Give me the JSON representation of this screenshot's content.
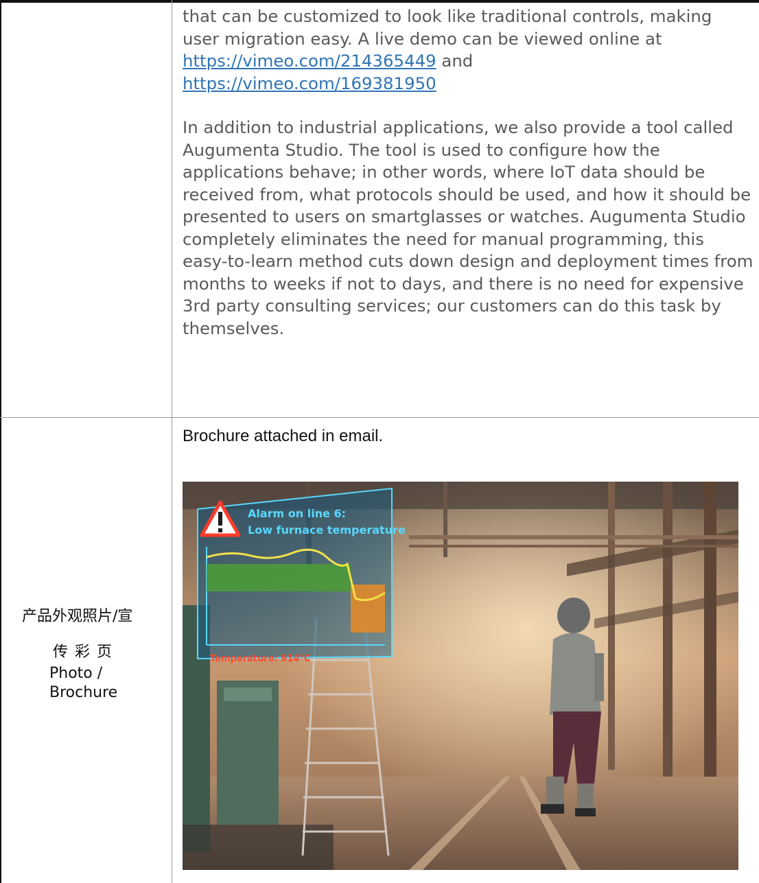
{
  "description": {
    "p1_text_a": "that can be customized to look like traditional controls, making user migration easy. A live demo can be viewed online at ",
    "link1": "https://vimeo.com/214365449",
    "p1_text_b": " and ",
    "link2": "https://vimeo.com/169381950",
    "p2": "In addition to industrial applications, we also provide a tool called Augumenta Studio. The tool is used to configure how the applications behave; in other words, where IoT data should be received from, what protocols should be used, and how it should be presented to users on smartglasses or watches. Augumenta Studio completely eliminates the need for manual programming, this easy-to-learn method cuts down design and deployment times from months to weeks if not to days, and there is no need for expensive 3rd party consulting services; our customers can do this task by themselves."
  },
  "row_label": {
    "cn_line1": "产品外观照片/宣",
    "cn_line2": "传彩页",
    "en_line1": "Photo /",
    "en_line2": "Brochure"
  },
  "brochure_note": "Brochure attached in email.",
  "photo": {
    "alarm_line1": "Alarm on line 6:",
    "alarm_line2": "Low furnace temperature",
    "temperature_label": "Temperature: 914°C"
  },
  "colors": {
    "link": "#2e74b5",
    "overlay_text": "#59d8ff",
    "temperature_text": "#ff4a2a"
  }
}
